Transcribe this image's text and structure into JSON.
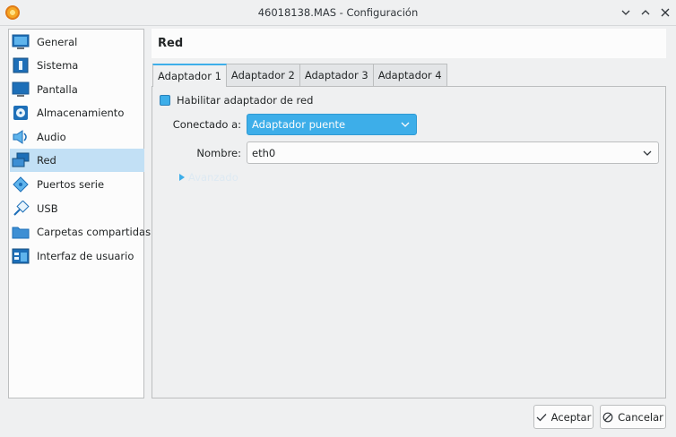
{
  "window": {
    "title": "46018138.MAS - Configuración"
  },
  "sidebar": {
    "items": [
      {
        "label": "General",
        "icon": "general-icon",
        "selected": false
      },
      {
        "label": "Sistema",
        "icon": "system-icon",
        "selected": false
      },
      {
        "label": "Pantalla",
        "icon": "display-icon",
        "selected": false
      },
      {
        "label": "Almacenamiento",
        "icon": "storage-icon",
        "selected": false
      },
      {
        "label": "Audio",
        "icon": "audio-icon",
        "selected": false
      },
      {
        "label": "Red",
        "icon": "network-icon",
        "selected": true
      },
      {
        "label": "Puertos serie",
        "icon": "serial-ports-icon",
        "selected": false
      },
      {
        "label": "USB",
        "icon": "usb-icon",
        "selected": false
      },
      {
        "label": "Carpetas compartidas",
        "icon": "shared-folders-icon",
        "selected": false
      },
      {
        "label": "Interfaz de usuario",
        "icon": "user-interface-icon",
        "selected": false
      }
    ]
  },
  "page": {
    "title": "Red"
  },
  "tabs": [
    {
      "label": "Adaptador 1",
      "active": true
    },
    {
      "label": "Adaptador 2",
      "active": false
    },
    {
      "label": "Adaptador 3",
      "active": false
    },
    {
      "label": "Adaptador 4",
      "active": false
    }
  ],
  "adapter": {
    "enable_label": "Habilitar adaptador de red",
    "enabled": true,
    "attached_label": "Conectado a:",
    "attached_value": "Adaptador puente",
    "name_label": "Nombre:",
    "name_value": "eth0",
    "advanced_label": "Avanzado"
  },
  "buttons": {
    "ok_label": "Aceptar",
    "cancel_label": "Cancelar"
  },
  "colors": {
    "accent": "#3daee9",
    "selection": "#c2e0f5"
  }
}
